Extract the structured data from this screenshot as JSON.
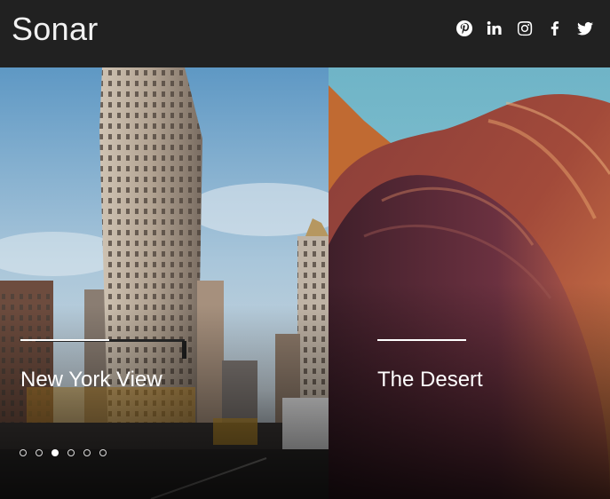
{
  "header": {
    "brand": "Sonar",
    "social": [
      {
        "name": "pinterest-icon"
      },
      {
        "name": "linkedin-icon",
        "glyph": "in"
      },
      {
        "name": "instagram-icon"
      },
      {
        "name": "facebook-icon",
        "glyph": "f"
      },
      {
        "name": "twitter-icon"
      }
    ]
  },
  "slides": [
    {
      "title": "New York View"
    },
    {
      "title": "The Desert"
    }
  ],
  "pagination": {
    "count": 6,
    "active_index": 2
  },
  "colors": {
    "header_bg": "#212121",
    "text": "#ffffff"
  }
}
